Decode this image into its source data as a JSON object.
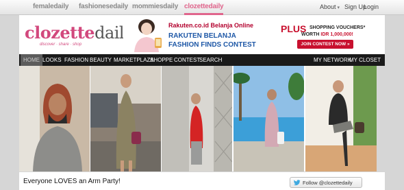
{
  "network": [
    {
      "label": "femaledaily",
      "active": false
    },
    {
      "label": "fashionesedaily",
      "active": false
    },
    {
      "label": "mommiesdaily",
      "active": false
    },
    {
      "label": "clozettedaily",
      "active": true
    }
  ],
  "top_links": {
    "about": "About",
    "signup": "Sign Up",
    "login": "Login"
  },
  "logo": {
    "part1": "clozette",
    "part2": "daily",
    "tagline": "discover · share · shop"
  },
  "ad": {
    "brand": "Rakuten.co.id Belanja Online",
    "title_line1": "RAKUTEN BELANJA",
    "title_line2": "FASHION FINDS CONTEST"
  },
  "promo": {
    "plus": "PLUS",
    "line1": "SHOPPING VOUCHERS*",
    "line2_prefix": "WORTH ",
    "line2_amount": "IDR 1,000,000!",
    "cta": "JOIN CONTEST NOW »"
  },
  "nav": {
    "left": [
      "HOME",
      "LOOKS",
      "FASHION",
      "BEAUTY",
      "MARKETPLAZA",
      "SHOPPE",
      "CONTEST",
      "SEARCH"
    ],
    "right": [
      "MY NETWORK",
      "MY CLOSET"
    ],
    "active": "HOME"
  },
  "headline": "Everyone LOVES an Arm Party!",
  "follow_label": "Follow @clozettedaily",
  "colors": {
    "brand_pink": "#d2487d",
    "nav_bg": "#1a1a1a",
    "ad_blue": "#1d57a6",
    "promo_red": "#c8102e",
    "twitter_blue": "#3fa9e0"
  }
}
